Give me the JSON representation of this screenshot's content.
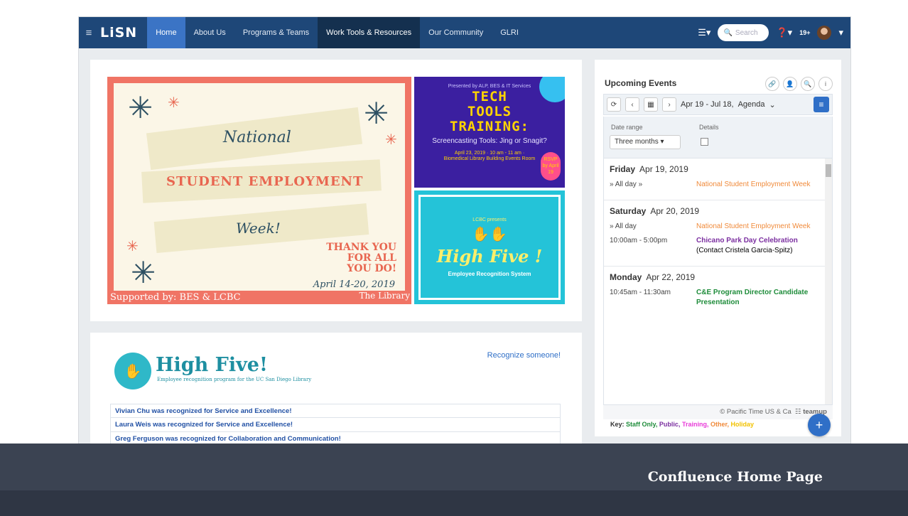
{
  "nav": {
    "logo": "LiSN",
    "tabs": [
      "Home",
      "About Us",
      "Programs & Teams",
      "Work Tools & Resources",
      "Our Community",
      "GLRI"
    ],
    "search_placeholder": "Search",
    "notif_count": "19+"
  },
  "hero": {
    "nsew": {
      "line1": "National",
      "line2": "STUDENT EMPLOYMENT",
      "line3": "Week!",
      "thanks": [
        "THANK YOU",
        "FOR ALL",
        "YOU DO!"
      ],
      "dates": "April 14-20, 2019",
      "supported": "Supported by: BES & LCBC",
      "library": "The Library"
    },
    "ttt": {
      "pre": "Presented by ALP, BES & IT Services",
      "title": [
        "TECH",
        "TOOLS",
        "TRAINING:"
      ],
      "sub": "Screencasting Tools: Jing or Snagit?",
      "info": "April 23, 2019 · 10 am - 11 am · Biomedical Library Building Events Room",
      "rsvp": "RSVP by April 19"
    },
    "hf": {
      "presents": "LCBC presents",
      "title": "High Five !",
      "sub": "Employee Recognition System"
    }
  },
  "highfive": {
    "title": "High Five!",
    "subtitle": "Employee recognition program for the UC San Diego Library",
    "recognize": "Recognize someone!",
    "items": [
      "Vivian Chu was recognized for Service and Excellence!",
      "Laura Weis was recognized for Service and Excellence!",
      "Greg Ferguson was recognized for Collaboration and Communication!"
    ]
  },
  "events": {
    "title": "Upcoming Events",
    "range": "Apr 19 - Jul 18,",
    "view": "Agenda",
    "date_range_label": "Date range",
    "details_label": "Details",
    "range_value": "Three months",
    "days": [
      {
        "day": "Friday",
        "date": "Apr 19, 2019",
        "events": [
          {
            "time": "» All day »",
            "title": "National Student Employment Week",
            "color": "orange",
            "extra": ""
          }
        ]
      },
      {
        "day": "Saturday",
        "date": "Apr 20, 2019",
        "events": [
          {
            "time": "» All day",
            "title": "National Student Employment Week",
            "color": "orange",
            "extra": ""
          },
          {
            "time": "10:00am - 5:00pm",
            "title": "Chicano Park Day Celebration",
            "color": "purple",
            "extra": " (Contact Cristela Garcia-Spitz)"
          }
        ]
      },
      {
        "day": "Monday",
        "date": "Apr 22, 2019",
        "events": [
          {
            "time": "10:45am - 11:30am",
            "title": "C&E Program Director Candidate Presentation",
            "color": "green",
            "extra": ""
          }
        ]
      }
    ],
    "timezone": "© Pacific Time US & Ca",
    "brand": "teamup",
    "key_label": "Key:",
    "key": [
      {
        "label": "Staff Only",
        "color": "#1e8c3a"
      },
      {
        "label": "Public",
        "color": "#7b2fa0"
      },
      {
        "label": "Training",
        "color": "#e83ad8"
      },
      {
        "label": "Other",
        "color": "#f08a3a"
      },
      {
        "label": "Holiday",
        "color": "#f2c200"
      }
    ]
  },
  "footer": {
    "title": "Confluence Home Page"
  }
}
